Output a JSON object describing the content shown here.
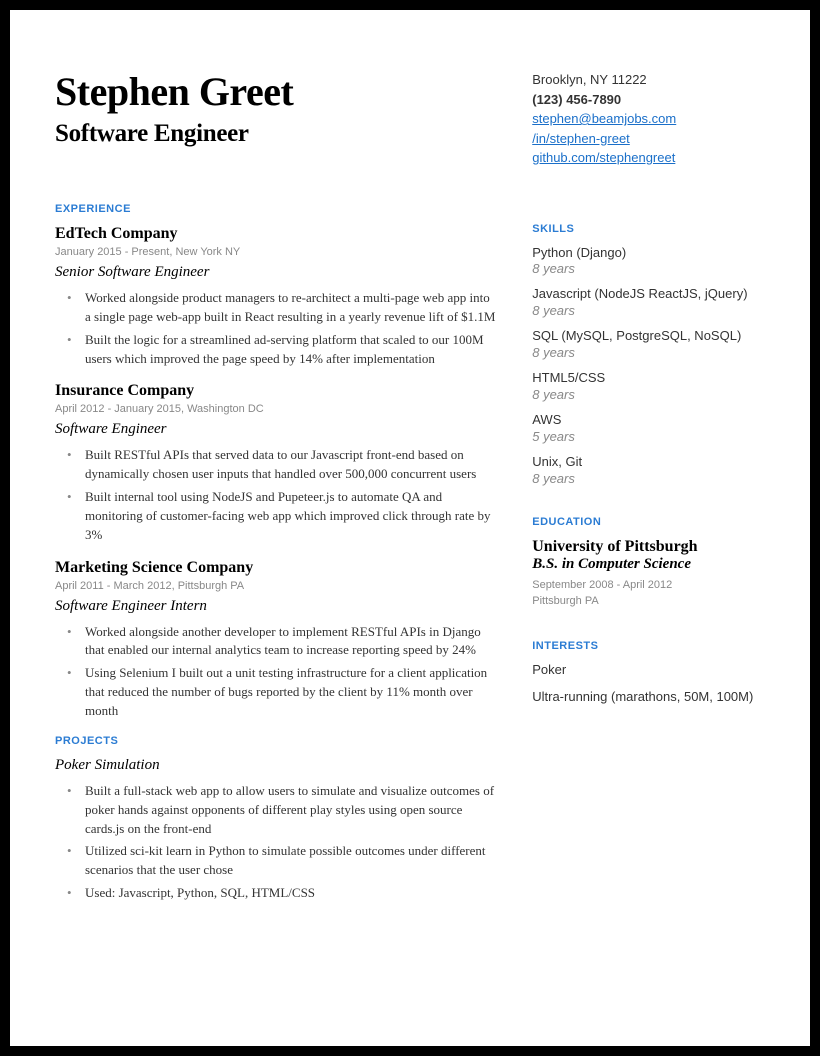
{
  "header": {
    "name": "Stephen Greet",
    "title": "Software Engineer"
  },
  "contact": {
    "location": "Brooklyn, NY 11222",
    "phone": "(123) 456-7890",
    "email": "stephen@beamjobs.com",
    "linkedin": "/in/stephen-greet",
    "github": "github.com/stephengreet"
  },
  "sections": {
    "experience_label": "EXPERIENCE",
    "projects_label": "PROJECTS",
    "skills_label": "SKILLS",
    "education_label": "EDUCATION",
    "interests_label": "INTERESTS"
  },
  "experience": [
    {
      "company": "EdTech Company",
      "dates": "January 2015 - Present, New York NY",
      "role": "Senior Software Engineer",
      "bullets": [
        "Worked alongside product managers to re-architect a multi-page web app into a single page web-app built in React resulting in a yearly revenue lift of $1.1M",
        "Built the logic for  a streamlined ad-serving platform that scaled to our 100M users which improved the page speed by 14% after implementation"
      ]
    },
    {
      "company": "Insurance Company",
      "dates": "April 2012 - January 2015, Washington DC",
      "role": "Software Engineer",
      "bullets": [
        "Built RESTful APIs that served data to our Javascript front-end based on dynamically chosen user inputs that handled over 500,000 concurrent users",
        "Built internal tool using NodeJS and Pupeteer.js to automate QA and monitoring of customer-facing web app which improved click through rate by 3%"
      ]
    },
    {
      "company": "Marketing Science Company",
      "dates": "April 2011 - March 2012, Pittsburgh PA",
      "role": "Software Engineer Intern",
      "bullets": [
        "Worked alongside another developer to implement RESTful APIs in Django that enabled our internal analytics team to increase reporting speed by 24%",
        "Using Selenium I built out a unit testing infrastructure for a client application that reduced the number of bugs reported by the client by 11% month over month"
      ]
    }
  ],
  "projects": [
    {
      "name": "Poker Simulation",
      "bullets": [
        "Built a full-stack web app to allow users to simulate and visualize outcomes of poker hands against opponents of different play styles using open source cards.js on the front-end",
        "Utilized  sci-kit learn in Python to simulate possible outcomes under different scenarios that the user chose",
        "Used: Javascript, Python, SQL, HTML/CSS"
      ]
    }
  ],
  "skills": [
    {
      "name": "Python (Django)",
      "years": "8 years"
    },
    {
      "name": "Javascript (NodeJS ReactJS, jQuery)",
      "years": "8 years"
    },
    {
      "name": "SQL  (MySQL, PostgreSQL, NoSQL)",
      "years": "8 years"
    },
    {
      "name": "HTML5/CSS",
      "years": "8 years"
    },
    {
      "name": "AWS",
      "years": "5 years"
    },
    {
      "name": "Unix, Git",
      "years": "8 years"
    }
  ],
  "education": {
    "school": "University of Pittsburgh",
    "degree": "B.S. in Computer Science",
    "dates": "September 2008 - April 2012",
    "location": "Pittsburgh PA"
  },
  "interests": [
    "Poker",
    "Ultra-running (marathons, 50M, 100M)"
  ]
}
